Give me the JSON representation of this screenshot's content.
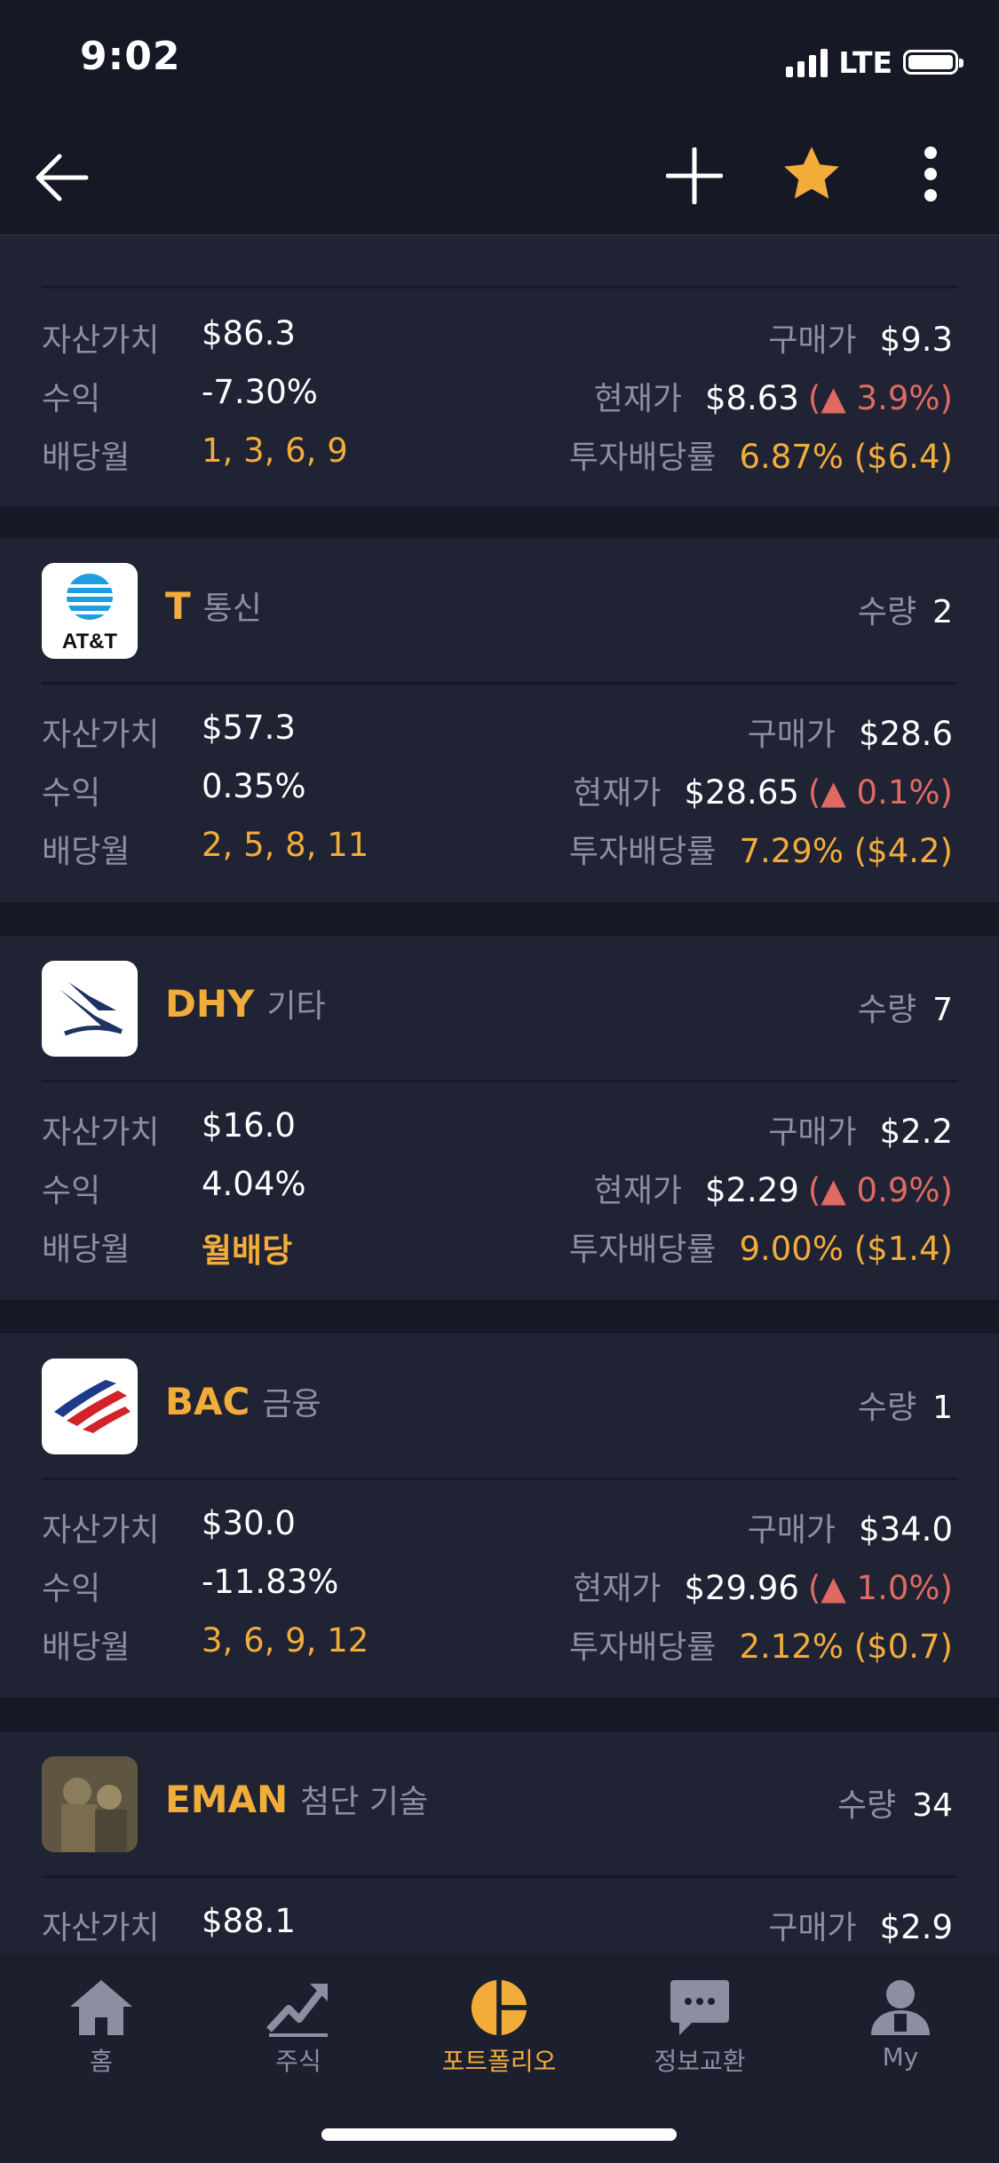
{
  "status_bar": {
    "time": "9:02",
    "network": "LTE"
  },
  "nav": {
    "back_icon": "arrow-left-icon",
    "add_icon": "plus-icon",
    "favorite_icon": "star-icon",
    "more_icon": "more-vertical-icon",
    "favorite_color": "#f2ac3a"
  },
  "labels": {
    "asset_value": "자산가치",
    "profit": "수익",
    "dividend_month": "배당월",
    "purchase_price": "구매가",
    "current_price": "현재가",
    "dividend_yield": "투자배당률",
    "quantity": "수량"
  },
  "top_card": {
    "asset_value": "$86.3",
    "profit": "-7.30%",
    "dividend_months": "1, 3, 6, 9",
    "purchase_price": "$9.3",
    "current_price": "$8.63",
    "change": "(▲ 3.9%)",
    "yield": "6.87% ($6.4)"
  },
  "holdings": [
    {
      "ticker": "T",
      "sector": "통신",
      "quantity": "2",
      "logo": "att-logo",
      "logo_text": "AT&T",
      "asset_value": "$57.3",
      "profit": "0.35%",
      "dividend_months": "2, 5, 8, 11",
      "purchase_price": "$28.6",
      "current_price": "$28.65",
      "change": "(▲ 0.1%)",
      "yield": "7.29% ($4.2)"
    },
    {
      "ticker": "DHY",
      "sector": "기타",
      "quantity": "7",
      "logo": "credit-suisse-sail-logo",
      "asset_value": "$16.0",
      "profit": "4.04%",
      "dividend_months": "월배당",
      "purchase_price": "$2.2",
      "current_price": "$2.29",
      "change": "(▲ 0.9%)",
      "yield": "9.00% ($1.4)"
    },
    {
      "ticker": "BAC",
      "sector": "금융",
      "quantity": "1",
      "logo": "bank-of-america-flag-logo",
      "asset_value": "$30.0",
      "profit": "-11.83%",
      "dividend_months": "3, 6, 9, 12",
      "purchase_price": "$34.0",
      "current_price": "$29.96",
      "change": "(▲ 1.0%)",
      "yield": "2.12% ($0.7)"
    },
    {
      "ticker": "EMAN",
      "sector": "첨단 기술",
      "quantity": "34",
      "logo": "eman-photo-logo",
      "asset_value": "$88.1",
      "purchase_price": "$2.9"
    }
  ],
  "tabs": [
    {
      "label": "홈",
      "icon": "home-icon",
      "active": false
    },
    {
      "label": "주식",
      "icon": "chart-trend-icon",
      "active": false
    },
    {
      "label": "포트폴리오",
      "icon": "pie-chart-icon",
      "active": true
    },
    {
      "label": "정보교환",
      "icon": "chat-bubble-icon",
      "active": false
    },
    {
      "label": "My",
      "icon": "user-icon",
      "active": false
    }
  ],
  "colors": {
    "accent": "#f2ac3a",
    "up": "#e06a62",
    "background": "#161925",
    "card": "#1f2334"
  }
}
